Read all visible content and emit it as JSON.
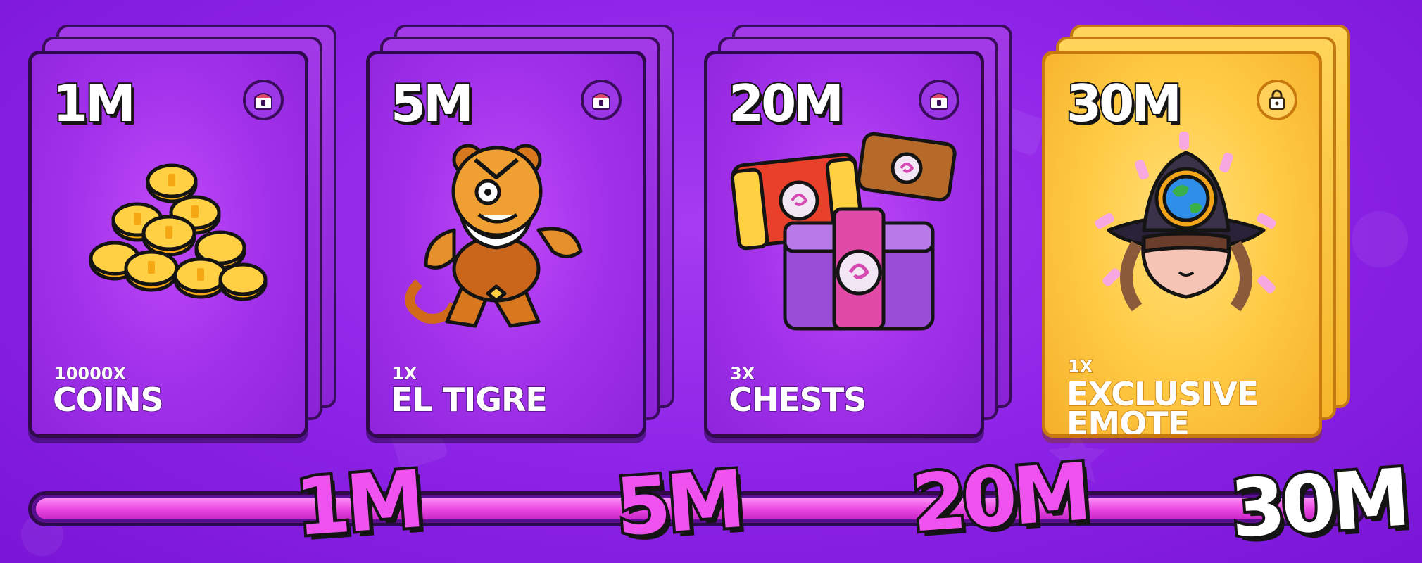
{
  "cards": [
    {
      "tier": "1M",
      "qty": "10000X",
      "name_lines": [
        "COINS"
      ],
      "reward": "coins",
      "locked": true,
      "style": "purple"
    },
    {
      "tier": "5M",
      "qty": "1X",
      "name_lines": [
        "EL TIGRE"
      ],
      "reward": "el-tigre",
      "locked": true,
      "style": "purple"
    },
    {
      "tier": "20M",
      "qty": "3X",
      "name_lines": [
        "CHESTS"
      ],
      "reward": "chests",
      "locked": true,
      "style": "purple"
    },
    {
      "tier": "30M",
      "qty": "1X",
      "name_lines": [
        "EXCLUSIVE",
        "EMOTE"
      ],
      "reward": "exclusive-emote",
      "locked": true,
      "style": "gold"
    }
  ],
  "progress": {
    "milestones": [
      "1M",
      "5M",
      "20M",
      "30M"
    ],
    "fill_fraction": 0.98
  },
  "colors": {
    "background": "#8c22e6",
    "card_purple": "#a534ec",
    "card_gold": "#ffcb45",
    "milestone_pink": "#f052ef",
    "outline": "#141414"
  }
}
